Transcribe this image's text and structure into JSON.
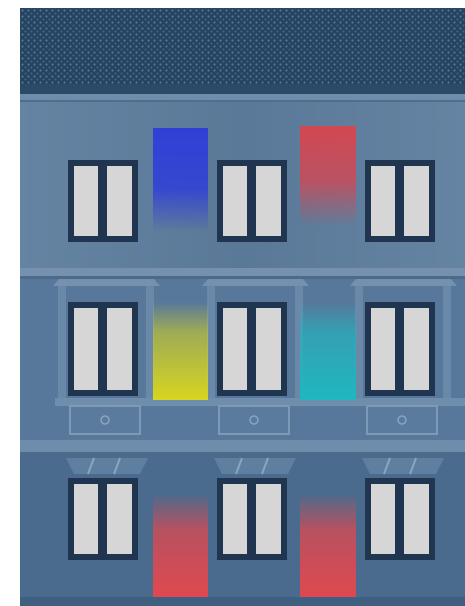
{
  "scene": {
    "subject": "building-facade",
    "colors": {
      "background": "#ffffff",
      "roof_base": "#25425f",
      "roof_dot": "#3f6385",
      "roof_dot_light": "#56799a",
      "roof_band": "#2b4a68",
      "upper_wall": "#5c7a99",
      "upper_wall_light": "#6583a2",
      "middle_wall": "#57789a",
      "lower_wall": "#4a6b8d",
      "lower_wall_light": "#537596",
      "cornice": "#6d8aa9",
      "cornice_shadow": "#4c6a8a",
      "ledge": "#7591af",
      "window_frame": "#1f3550",
      "window_glass": "#d6d6d6",
      "window_glass_shadow": "#bfbfbf",
      "panel": "#5a7b9d",
      "panel_border": "#7d99b6",
      "panel_circle": "#8aa4be",
      "keystone": "#5e7fa0",
      "keystone_line": "#8ba5bf"
    },
    "light_strips": [
      {
        "name": "blue-light-strip",
        "color": "#3040d6",
        "fade": "down",
        "opacity": 1.0
      },
      {
        "name": "red-light-strip-upper",
        "color": "#d34752",
        "fade": "down",
        "opacity": 1.0
      },
      {
        "name": "yellow-light-strip",
        "color": "#d7d51f",
        "fade": "up",
        "opacity": 1.0
      },
      {
        "name": "cyan-light-strip",
        "color": "#1fb7c1",
        "fade": "up",
        "opacity": 1.0
      },
      {
        "name": "red-light-strip-lower-left",
        "color": "#e0484f",
        "fade": "up",
        "opacity": 1.0
      },
      {
        "name": "red-light-strip-lower-right",
        "color": "#e0484f",
        "fade": "up",
        "opacity": 1.0
      }
    ]
  }
}
